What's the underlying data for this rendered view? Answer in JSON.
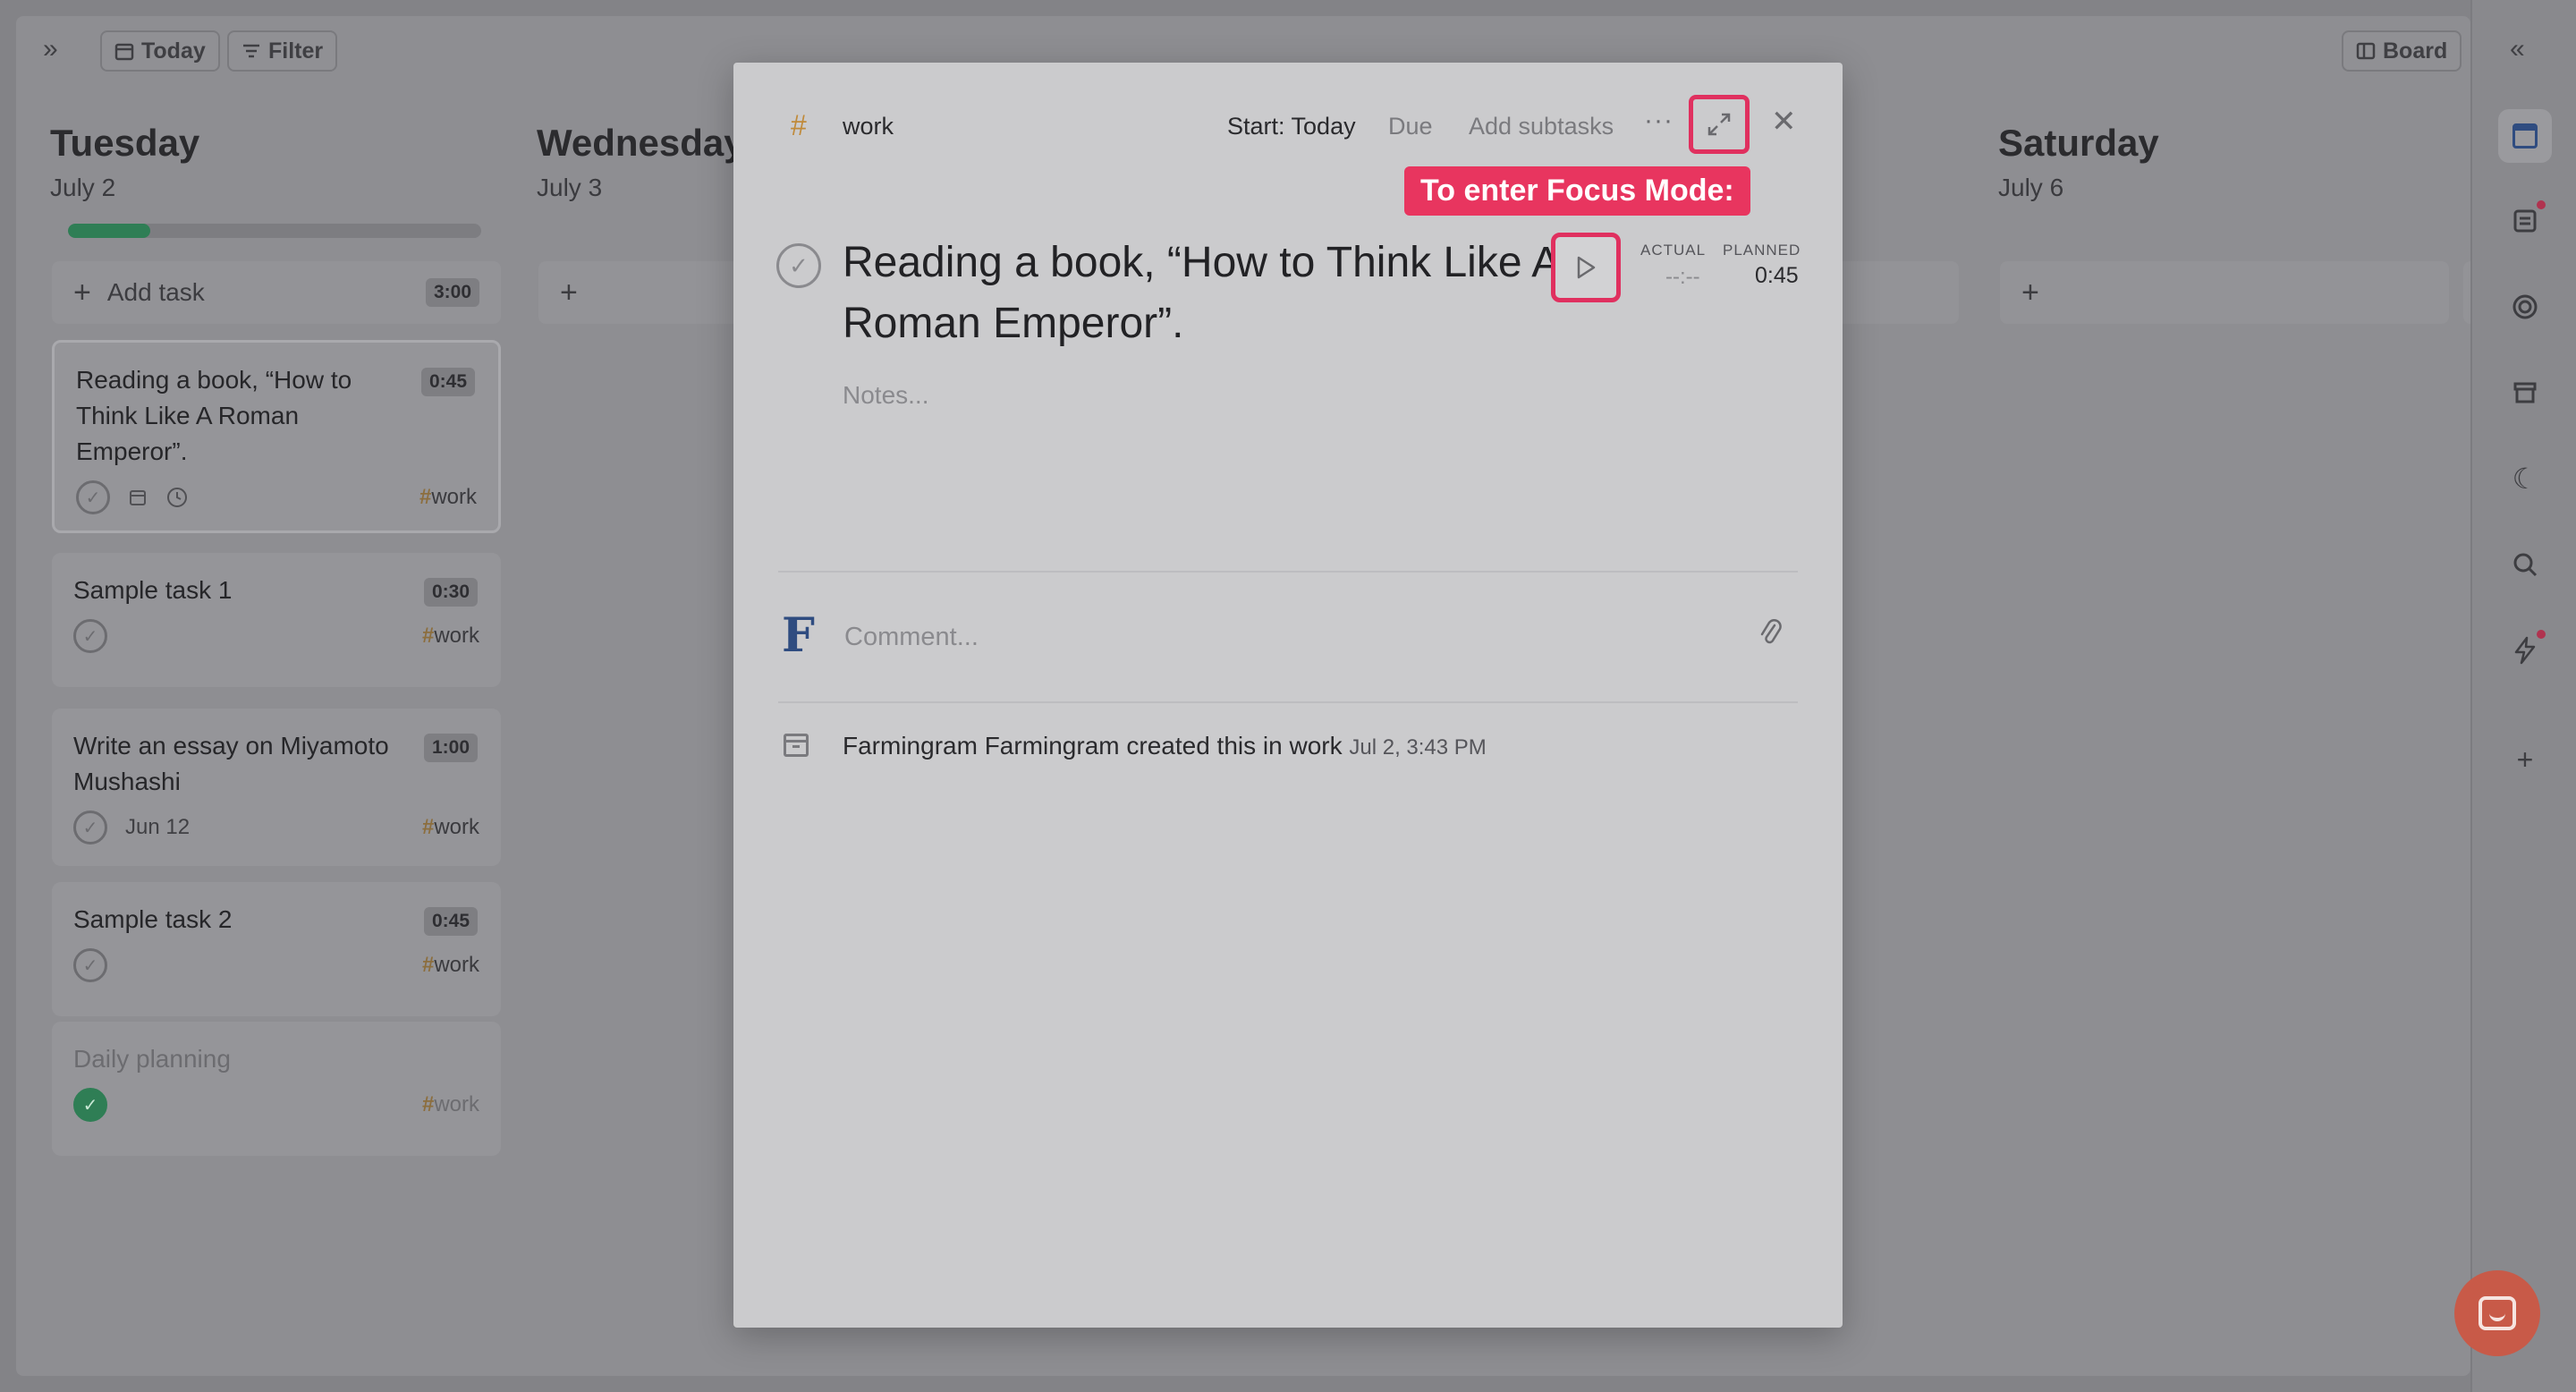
{
  "toolbar": {
    "today_label": "Today",
    "filter_label": "Filter",
    "board_label": "Board"
  },
  "columns": [
    {
      "day": "Tuesday",
      "date": "July 2",
      "progress_fraction": 0.2,
      "add_label": "Add task",
      "add_badge": "3:00",
      "cards": [
        {
          "title": "Reading a book, “How to Think Like A Roman Emperor”.",
          "badge": "0:45",
          "date": "",
          "tag": "work"
        },
        {
          "title": "Sample task 1",
          "badge": "0:30",
          "date": "",
          "tag": "work"
        },
        {
          "title": "Write an essay on Miyamoto Mushashi",
          "badge": "1:00",
          "date": "Jun 12",
          "tag": "work"
        },
        {
          "title": "Sample task 2",
          "badge": "0:45",
          "date": "",
          "tag": "work"
        },
        {
          "title": "Daily planning",
          "badge": "",
          "date": "",
          "tag": "work"
        }
      ]
    },
    {
      "day": "Wednesday",
      "date": "July 3"
    },
    {
      "day": "Saturday",
      "date": "July 6"
    }
  ],
  "modal": {
    "project": "work",
    "start_label": "Start: Today",
    "due_label": "Due",
    "subtasks_label": "Add subtasks",
    "more_label": "···",
    "callout": "To enter Focus Mode:",
    "title": "Reading a book, “How to Think Like A Roman Emperor”.",
    "actual_label": "ACTUAL",
    "actual_value": "--:--",
    "planned_label": "PLANNED",
    "planned_value": "0:45",
    "notes_placeholder": "Notes...",
    "avatar_letter": "F",
    "comment_placeholder": "Comment...",
    "activity_text": "Farmingram Farmingram created this in work",
    "activity_time": "Jul 2, 3:43 PM"
  },
  "colors": {
    "accent_pink": "#e8355f",
    "progress_green": "#2f7e55",
    "tag_orange": "#c08a3a",
    "chat_button": "#c85a48"
  }
}
